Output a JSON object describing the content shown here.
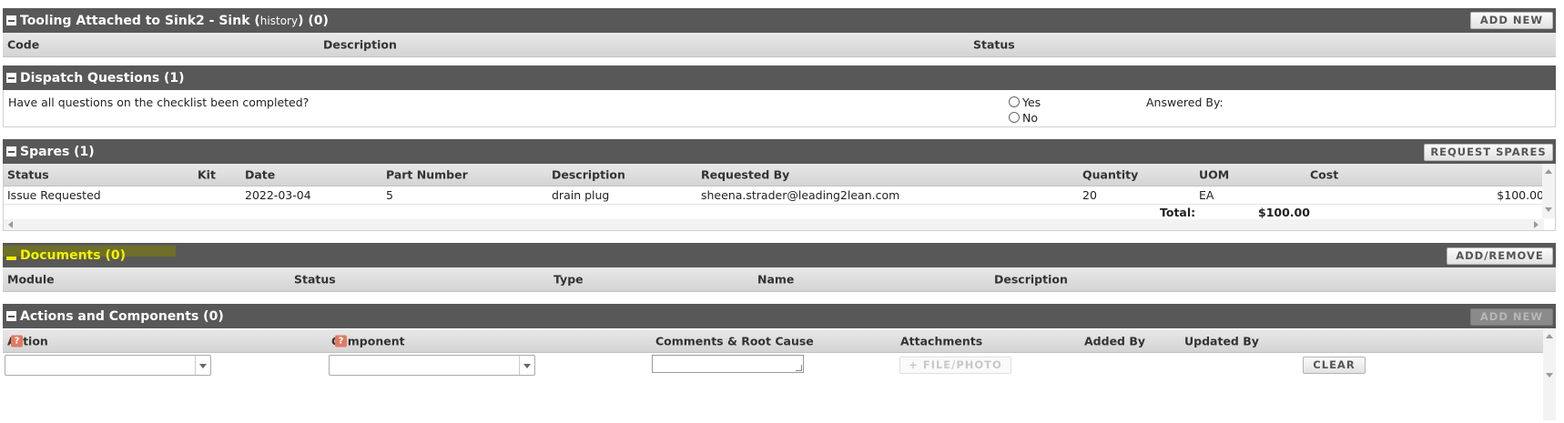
{
  "tooling": {
    "title": "Tooling Attached to Sink2 - Sink (",
    "history": "history",
    "title_end": ") (0)",
    "add_new": "ADD NEW",
    "columns": [
      "Code",
      "Description",
      "Status"
    ]
  },
  "dispatch": {
    "title": "Dispatch Questions (1)",
    "question": "Have all questions on the checklist been completed?",
    "yes": "Yes",
    "no": "No",
    "answered_by": "Answered By:"
  },
  "spares": {
    "title": "Spares (1)",
    "request": "REQUEST SPARES",
    "columns": [
      "Status",
      "Kit",
      "Date",
      "Part Number",
      "Description",
      "Requested By",
      "Quantity",
      "UOM",
      "Cost"
    ],
    "row": {
      "status": "Issue Requested",
      "kit": "",
      "date": "2022-03-04",
      "part": "5",
      "description": "drain plug",
      "requested_by": "sheena.strader@leading2lean.com",
      "quantity": "20",
      "uom": "EA",
      "cost": "$100.00"
    },
    "total_label": "Total:",
    "total_value": "$100.00"
  },
  "documents": {
    "title": "Documents (0)",
    "add_remove": "ADD/REMOVE",
    "columns": [
      "Module",
      "Status",
      "Type",
      "Name",
      "Description"
    ],
    "highlight_color": "#f2f200"
  },
  "actions": {
    "title": "Actions and Components (0)",
    "add_new": "ADD NEW",
    "columns": [
      "Action",
      "Component",
      "Comments & Root Cause",
      "Attachments",
      "Added By",
      "Updated By"
    ],
    "help_glyph": "?",
    "file_photo": "+ FILE/PHOTO",
    "clear": "CLEAR"
  }
}
